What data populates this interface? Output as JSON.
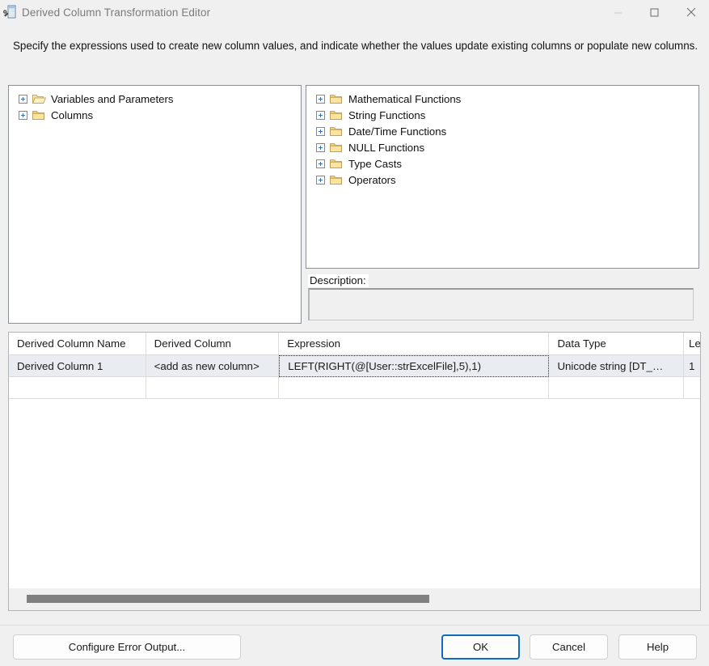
{
  "window": {
    "title": "Derived Column Transformation Editor",
    "icon": "derived-column-icon",
    "controls": {
      "minimize": "minimize-icon",
      "maximize": "maximize-icon",
      "close": "close-icon"
    }
  },
  "instruction": "Specify the expressions used to create new column values, and indicate whether the values update existing columns or populate new columns.",
  "left_tree": {
    "items": [
      {
        "label": "Variables and Parameters",
        "icon": "folder-open-icon",
        "expander": "plus-icon"
      },
      {
        "label": "Columns",
        "icon": "folder-icon",
        "expander": "plus-icon"
      }
    ]
  },
  "right_tree": {
    "items": [
      {
        "label": "Mathematical Functions",
        "icon": "folder-icon",
        "expander": "plus-icon"
      },
      {
        "label": "String Functions",
        "icon": "folder-icon",
        "expander": "plus-icon"
      },
      {
        "label": "Date/Time Functions",
        "icon": "folder-icon",
        "expander": "plus-icon"
      },
      {
        "label": "NULL Functions",
        "icon": "folder-icon",
        "expander": "plus-icon"
      },
      {
        "label": "Type Casts",
        "icon": "folder-icon",
        "expander": "plus-icon"
      },
      {
        "label": "Operators",
        "icon": "folder-icon",
        "expander": "plus-icon"
      }
    ]
  },
  "description": {
    "label": "Description:",
    "value": ""
  },
  "grid": {
    "headers": [
      "Derived Column Name",
      "Derived Column",
      "Expression",
      "Data Type",
      "Le"
    ],
    "rows": [
      {
        "derived_column_name": "Derived Column 1",
        "derived_column": "<add as new column>",
        "expression": "LEFT(RIGHT(@[User::strExcelFile],5),1)",
        "data_type": "Unicode string [DT_…",
        "length": "1"
      }
    ],
    "empty_row": [
      "",
      "",
      "",
      "",
      ""
    ]
  },
  "footer": {
    "configure_error_output": "Configure Error Output...",
    "ok": "OK",
    "cancel": "Cancel",
    "help": "Help"
  },
  "colors": {
    "dialog_background": "#f0f0f0",
    "panel_background": "#ffffff",
    "selected_row": "#e9edf1",
    "primary_focus": "#0f6cbd",
    "scrollbar_thumb": "#808080",
    "title_text": "#7a7a7a"
  }
}
